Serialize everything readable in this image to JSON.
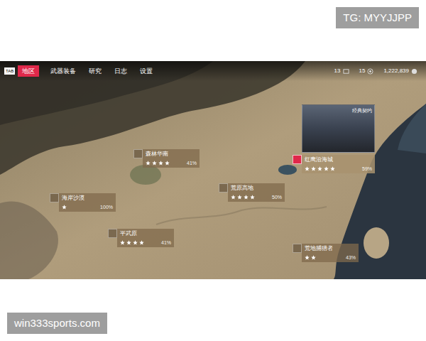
{
  "watermarks": {
    "top": "TG: MYYJJPP",
    "bottom": "win333sports.com"
  },
  "nav": {
    "key": "TAB",
    "tabs": [
      {
        "label": "地区",
        "selected": true
      },
      {
        "label": "武器装备",
        "selected": false
      },
      {
        "label": "研究",
        "selected": false
      },
      {
        "label": "日志",
        "selected": false
      },
      {
        "label": "设置",
        "selected": false
      }
    ]
  },
  "resources": [
    {
      "value": "13"
    },
    {
      "value": "15"
    },
    {
      "value": "1,222,839"
    }
  ],
  "preview": {
    "title": "经典契约"
  },
  "regions": [
    {
      "name": "森林华南",
      "stars": 4,
      "progress": "41%",
      "selected": false
    },
    {
      "name": "海岸沙漠",
      "stars": 1,
      "progress": "100%",
      "selected": false
    },
    {
      "name": "荒原高地",
      "stars": 4,
      "progress": "50%",
      "selected": false
    },
    {
      "name": "平武原",
      "stars": 4,
      "progress": "41%",
      "selected": false
    },
    {
      "name": "红鹰沿海城",
      "stars": 5,
      "progress": "59%",
      "selected": true
    },
    {
      "name": "荒地捕猎者",
      "stars": 2,
      "progress": "43%",
      "selected": false
    }
  ]
}
